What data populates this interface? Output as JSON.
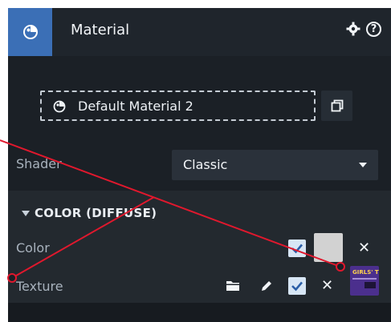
{
  "header": {
    "title": "Material",
    "icons": [
      "material-icon",
      "gear-icon",
      "help-icon"
    ],
    "help_glyph": "?"
  },
  "material": {
    "name": "Default Material 2",
    "icons": [
      "material-icon",
      "copy-icon"
    ]
  },
  "shader": {
    "label": "Shader",
    "value": "Classic"
  },
  "color_section": {
    "title": "COLOR (DIFFUSE)",
    "color_row": {
      "label": "Color",
      "enabled": true,
      "swatch": "#d2d2d2",
      "clear_glyph": "✕"
    },
    "texture_row": {
      "label": "Texture",
      "enabled": true,
      "tools": [
        "folder-icon",
        "pencil-icon",
        "check-icon",
        "close-icon"
      ],
      "clear_glyph": "✕",
      "thumbnail_text": "GIRLS' TI"
    }
  },
  "colors": {
    "accent": "#3b6fb6",
    "annotation": "#e0182d",
    "panel": "#1b2026"
  }
}
